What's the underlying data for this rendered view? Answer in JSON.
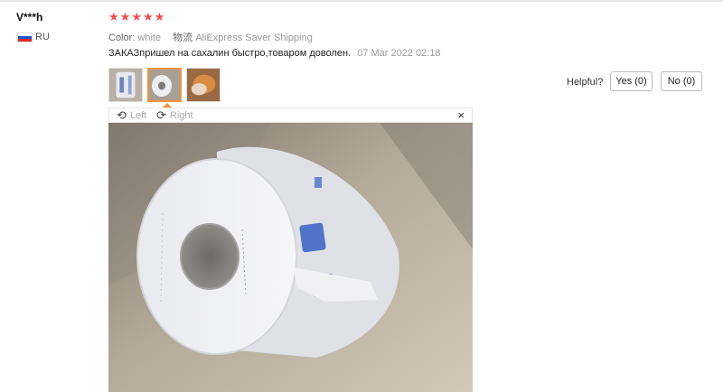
{
  "reviewer": {
    "name": "V***h",
    "country": "RU"
  },
  "rating": {
    "stars": 5,
    "glyph": "★"
  },
  "attributes": {
    "color_label": "Color:",
    "color_value": "white",
    "shipping_label": "物流",
    "shipping_value": "AliExpress Saver Shipping"
  },
  "review": {
    "text": "ЗАКАЗпришел на сахалин быстро,товаром доволен.",
    "date": "07 Mar 2022 02:18"
  },
  "viewer": {
    "rotate_left": "Left",
    "rotate_right": "Right",
    "close": "×",
    "left_icon": "rotate-left-icon",
    "right_icon": "rotate-right-icon"
  },
  "helpful": {
    "label": "Helpful?",
    "yes": "Yes (0)",
    "no": "No (0)"
  },
  "colors": {
    "star": "#f24d4d",
    "active_thumb": "#f29240"
  }
}
